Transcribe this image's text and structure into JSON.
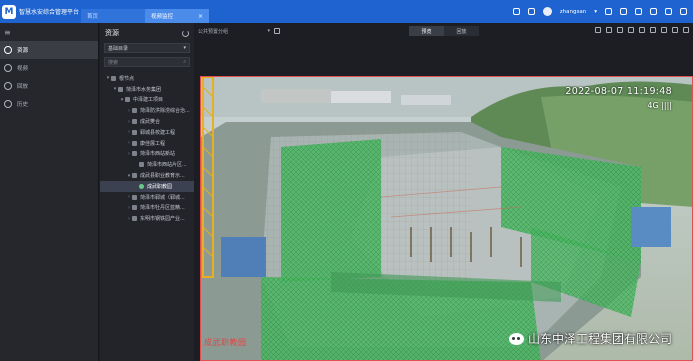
{
  "app": {
    "logo": "M",
    "title": "智慧水安综合管理平台"
  },
  "tabs": [
    {
      "label": "首页"
    },
    {
      "label": "视频监控",
      "close": "×"
    }
  ],
  "topbar": {
    "user": "zhangsan",
    "user_caret": "▾"
  },
  "leftnav": {
    "collapse": "≡",
    "items": [
      {
        "label": "资源"
      },
      {
        "label": "视频"
      },
      {
        "label": "回放"
      },
      {
        "label": "历史"
      }
    ]
  },
  "resource": {
    "title": "资源",
    "directory": "基础目录",
    "search_placeholder": "搜索",
    "tree": [
      {
        "label": "根节点",
        "caret": "▾",
        "indent": 1,
        "type": "root"
      },
      {
        "label": "菏泽市水务集团",
        "caret": "▾",
        "indent": 2,
        "type": "org"
      },
      {
        "label": "中泽建工项目",
        "caret": "▾",
        "indent": 3,
        "type": "org"
      },
      {
        "label": "菏泽防洪除涝综合治...",
        "caret": "›",
        "indent": 4,
        "type": "org"
      },
      {
        "label": "成武樊合",
        "caret": "›",
        "indent": 4,
        "type": "org"
      },
      {
        "label": "郓城县校建工程",
        "caret": "›",
        "indent": 4,
        "type": "org"
      },
      {
        "label": "康佳展工程",
        "caret": "›",
        "indent": 4,
        "type": "org"
      },
      {
        "label": "菏泽市西站新站",
        "caret": "›",
        "indent": 4,
        "type": "org"
      },
      {
        "label": "菏泽市西站片区...",
        "caret": "",
        "indent": 5,
        "type": "org"
      },
      {
        "label": "成武县职业教育示...",
        "caret": "▾",
        "indent": 4,
        "type": "org"
      },
      {
        "label": "成武职教园",
        "caret": "",
        "indent": 5,
        "type": "camera",
        "selected": true
      },
      {
        "label": "菏泽市郓城（郓城...",
        "caret": "›",
        "indent": 4,
        "type": "org"
      },
      {
        "label": "菏泽市牡丹区蓝精...",
        "caret": "›",
        "indent": 4,
        "type": "org"
      },
      {
        "label": "东明市钢铁园产业...",
        "caret": "›",
        "indent": 4,
        "type": "org"
      }
    ]
  },
  "main": {
    "view_select": "公共预置分组",
    "view_caret": "▾",
    "modes": [
      {
        "label": "预览"
      },
      {
        "label": "回放"
      }
    ],
    "active_mode": 0
  },
  "video": {
    "timestamp": "2022-08-07 11:19:48",
    "signal": "4G ||||",
    "channel_name": "成武职教园",
    "watermark": "山东中泽工程集团有限公司"
  },
  "colors": {
    "topbar": "#1e63cf",
    "panel": "#22242a",
    "selected": "#3b4150",
    "osd_red": "#e24646",
    "safety_net": "#4fc86a"
  }
}
